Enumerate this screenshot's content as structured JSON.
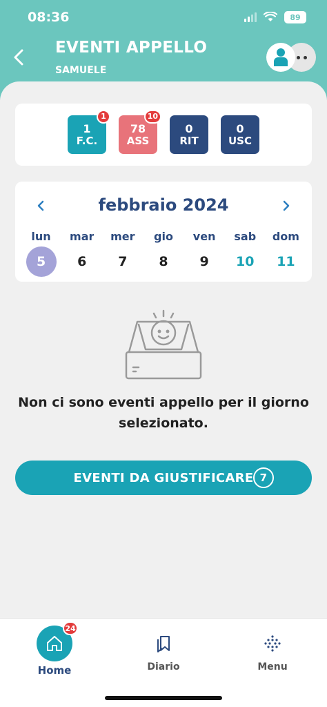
{
  "status_bar": {
    "time": "08:36",
    "battery": "89"
  },
  "header": {
    "title": "EVENTI APPELLO",
    "subtitle": "SAMUELE"
  },
  "counters": [
    {
      "value": "1",
      "label": "F.C.",
      "badge": "1",
      "color": "#1aa3b5"
    },
    {
      "value": "78",
      "label": "ASS",
      "badge": "10",
      "color": "#e8737a"
    },
    {
      "value": "0",
      "label": "RIT",
      "badge": "",
      "color": "#2c4a7e"
    },
    {
      "value": "0",
      "label": "USC",
      "badge": "",
      "color": "#2c4a7e"
    }
  ],
  "calendar": {
    "month": "febbraio 2024",
    "days": [
      {
        "name": "lun",
        "date": "5",
        "selected": true
      },
      {
        "name": "mar",
        "date": "6"
      },
      {
        "name": "mer",
        "date": "7"
      },
      {
        "name": "gio",
        "date": "8"
      },
      {
        "name": "ven",
        "date": "9"
      },
      {
        "name": "sab",
        "date": "10",
        "weekend": true
      },
      {
        "name": "dom",
        "date": "11",
        "weekend": true
      }
    ]
  },
  "empty_state": {
    "message": "Non ci sono eventi appello per il giorno selezionato."
  },
  "justify_button": {
    "label": "EVENTI DA GIUSTIFICARE",
    "badge": "7"
  },
  "bottom_nav": {
    "home": {
      "label": "Home",
      "badge": "24"
    },
    "diario": {
      "label": "Diario"
    },
    "menu": {
      "label": "Menu"
    }
  },
  "colors": {
    "header": "#6bc6be",
    "accent": "#1aa3b5",
    "navy": "#2c4a7e",
    "absence": "#e8737a",
    "selected_day": "#a4a3d8",
    "badge": "#e33b3b"
  },
  "icons": [
    "back-chevron-icon",
    "user-icon",
    "more-dots-icon",
    "calendar-prev-icon",
    "calendar-next-icon",
    "empty-inbox-icon",
    "home-icon",
    "bookmark-icon",
    "grid-dots-icon"
  ]
}
